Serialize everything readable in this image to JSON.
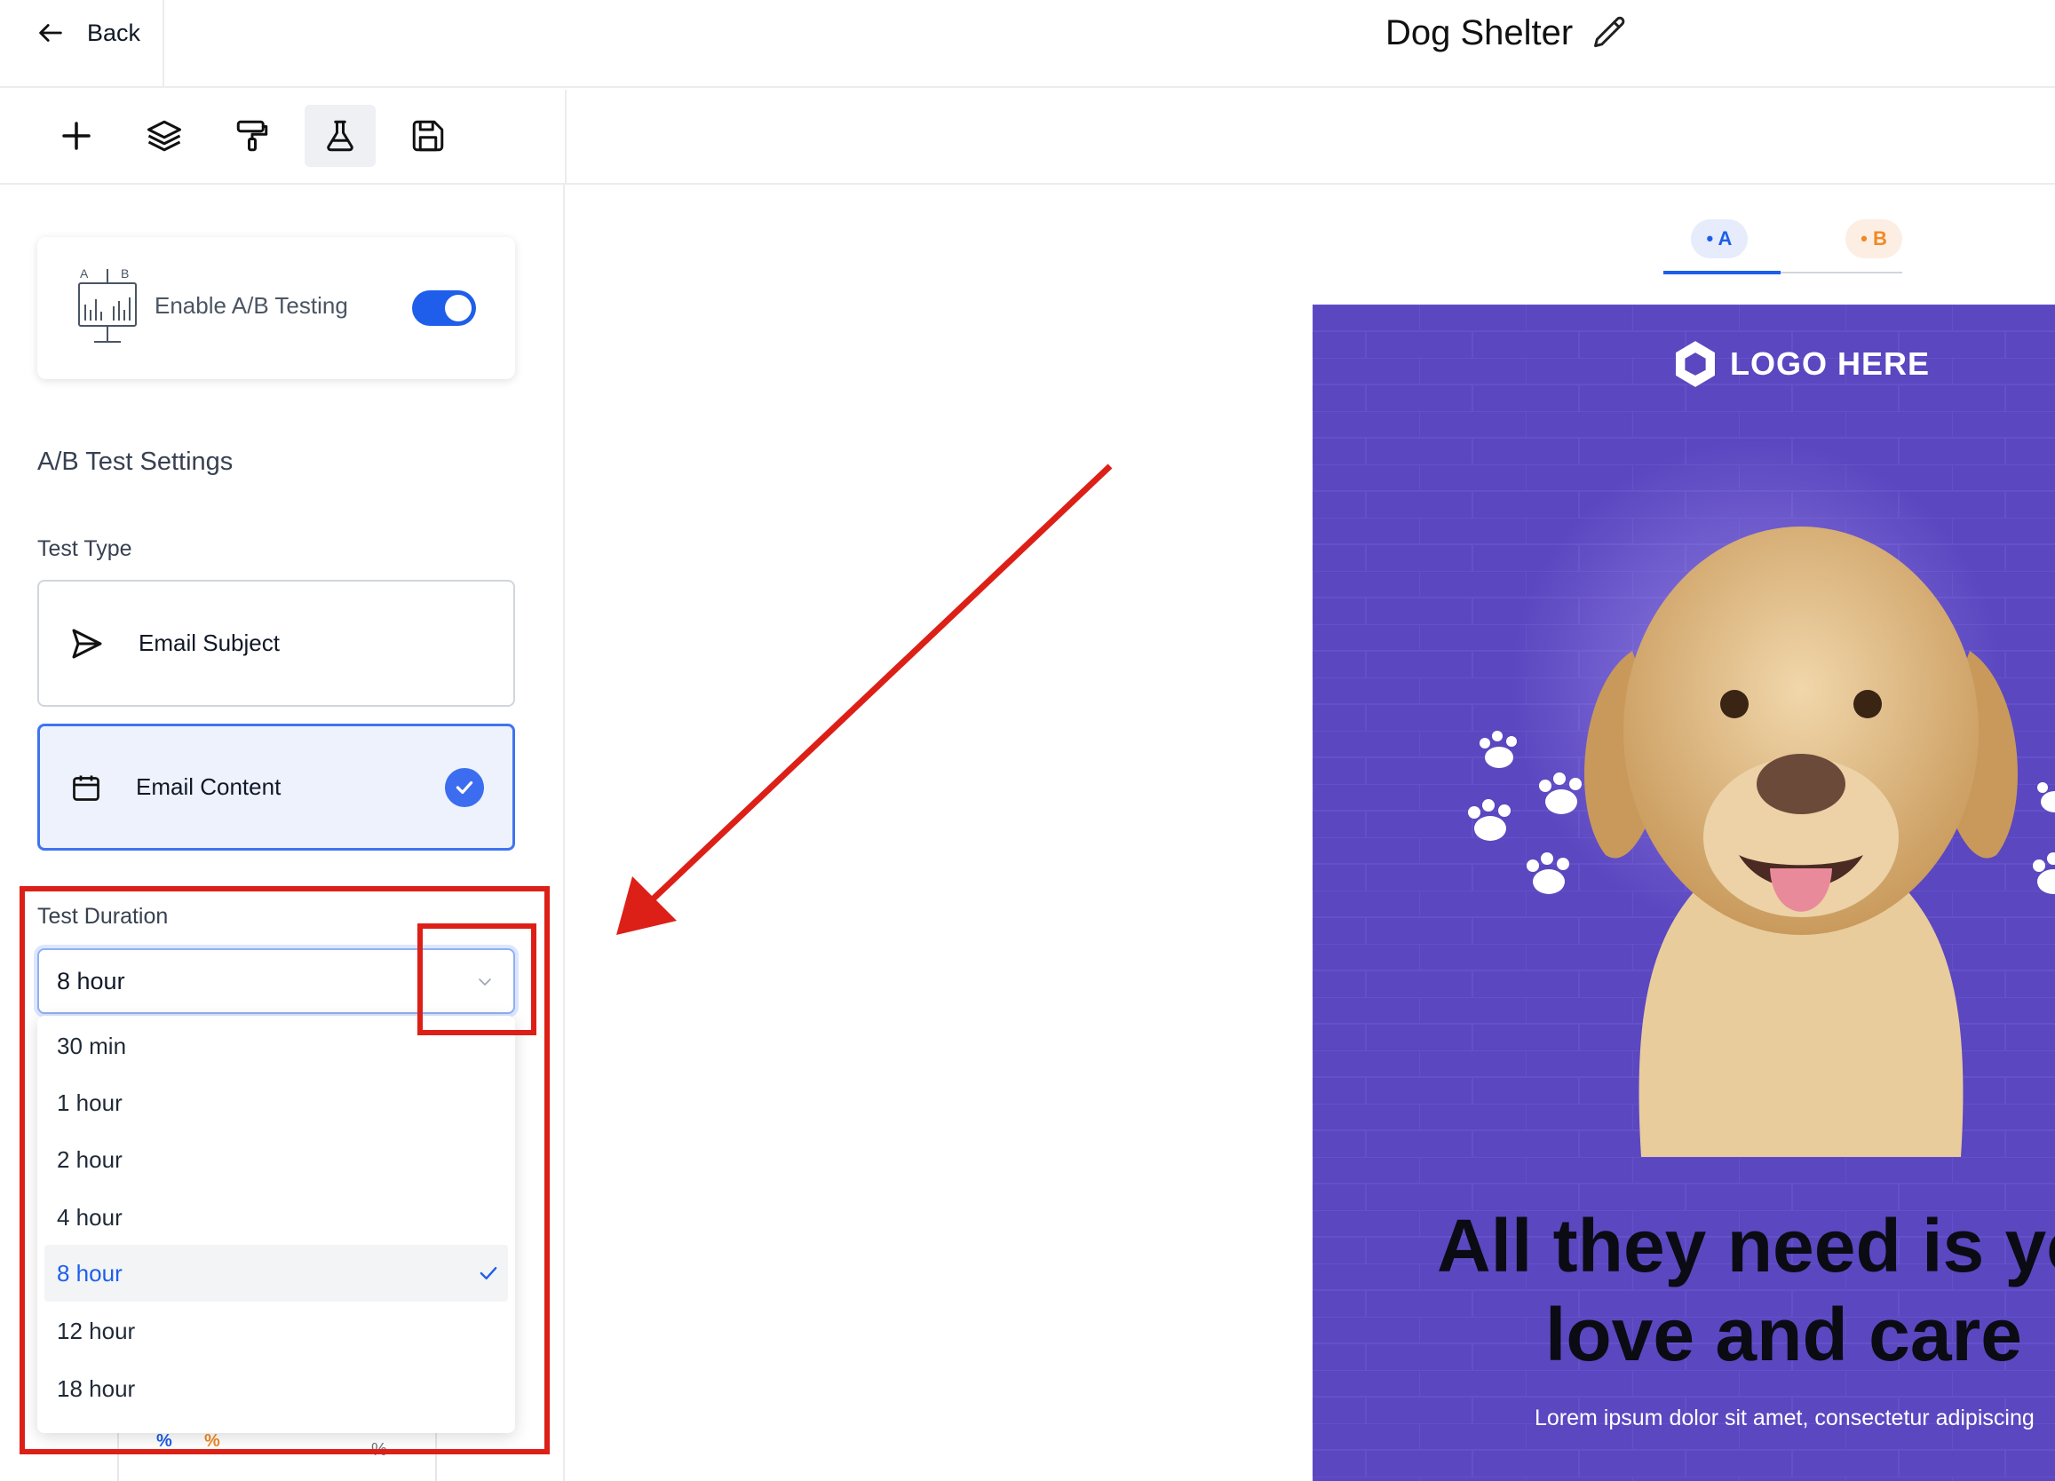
{
  "header": {
    "back_label": "Back",
    "title": "Dog Shelter"
  },
  "toolbar": {
    "tools": [
      "add-icon",
      "layers-icon",
      "paint-roller-icon",
      "flask-icon",
      "save-icon"
    ],
    "active_tool": "flask-icon"
  },
  "ab_testing": {
    "enable_label": "Enable A/B Testing",
    "icon_letters": [
      "A",
      "B"
    ],
    "enabled": true
  },
  "settings": {
    "section_title": "A/B Test Settings",
    "test_type_label": "Test Type",
    "test_types": [
      {
        "label": "Email Subject",
        "icon": "send-icon",
        "selected": false
      },
      {
        "label": "Email Content",
        "icon": "calendar-icon",
        "selected": true
      }
    ],
    "duration_label": "Test Duration",
    "duration_value": "8 hour",
    "duration_options": [
      "30 min",
      "1 hour",
      "2 hour",
      "4 hour",
      "8 hour",
      "12 hour",
      "18 hour"
    ],
    "duration_selected_index": 4
  },
  "variants": {
    "a_label": "A",
    "b_label": "B",
    "active": "A"
  },
  "email_preview": {
    "logo_text": "LOGO HERE",
    "headline_line1": "All they need is yo",
    "headline_line2": "love and care",
    "body_text": "Lorem ipsum dolor sit amet, consectetur adipiscing"
  },
  "background_fragments": {
    "pct_a": "%",
    "pct_b": "%",
    "pct_c": "%"
  },
  "colors": {
    "accent": "#1e5eea",
    "variant_b": "#f08a24",
    "email_bg": "#5b47c0",
    "annotation": "#dc2018"
  }
}
